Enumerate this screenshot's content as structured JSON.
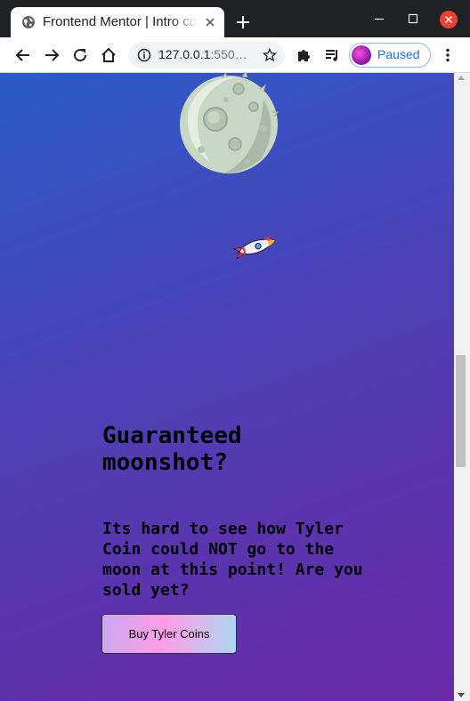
{
  "browser": {
    "tab_title": "Frontend Mentor | Intro component with sign up form",
    "url_host": "127.0.0.1",
    "url_rest": ":550…",
    "profile_label": "Paused"
  },
  "page": {
    "heading": "Guaranteed moonshot?",
    "copy": "Its hard to see how Tyler Coin could NOT go to the moon at this point! Are you sold yet?",
    "cta_label": "Buy Tyler Coins"
  },
  "icons": {
    "favicon": "globe-icon",
    "back": "arrow-left-icon",
    "forward": "arrow-right-icon",
    "reload": "reload-icon",
    "home": "home-icon",
    "site_info": "info-icon",
    "bookmark": "star-icon",
    "extensions": "puzzle-icon",
    "media": "media-queue-icon",
    "menu": "kebab-menu-icon"
  },
  "colors": {
    "gradient_start": "#2b5cc8",
    "gradient_end": "#6a2aa8",
    "cta_pink": "#ff9ce6",
    "profile_accent": "#1a73e8"
  }
}
